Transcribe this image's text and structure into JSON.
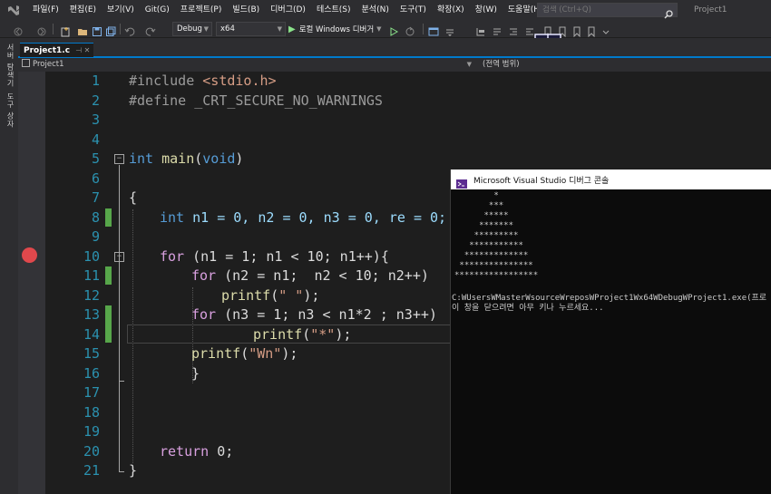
{
  "menu": {
    "items": [
      "파일(F)",
      "편집(E)",
      "보기(V)",
      "Git(G)",
      "프로젝트(P)",
      "빌드(B)",
      "디버그(D)",
      "테스트(S)",
      "분석(N)",
      "도구(T)",
      "확장(X)",
      "창(W)",
      "도움말(H)"
    ],
    "search_placeholder": "검색 (Ctrl+Q)",
    "project_title": "Project1"
  },
  "toolbar": {
    "configuration": "Debug",
    "platform": "x64",
    "run_label": "로컬 Windows 디버거"
  },
  "side_panel": {
    "tabs": [
      "서버 탐색기",
      "도구 상자"
    ]
  },
  "tab": {
    "file_name": "Project1.c",
    "close_glyphs": "⊣ ✕"
  },
  "navbar": {
    "project": "Project1",
    "scope": "(전역 범위)"
  },
  "editor": {
    "line_numbers": [
      "1",
      "2",
      "3",
      "4",
      "5",
      "6",
      "7",
      "8",
      "9",
      "10",
      "11",
      "12",
      "13",
      "14",
      "15",
      "16",
      "17",
      "18",
      "19",
      "20",
      "21"
    ],
    "code": {
      "l1_directive": "#include ",
      "l1_header": "<stdio.h>",
      "l2_directive": "#define ",
      "l2_macro": "_CRT_SECURE_NO_WARNINGS",
      "l5_type": "int",
      "l5_fn": "main",
      "l5_open": "(",
      "l5_void": "void",
      "l5_close": ")",
      "l7": "{",
      "l8_type": "int",
      "l8_rest": " n1 = 0, n2 = 0, n3 = 0, re = 0;",
      "l10_kw": "for",
      "l10_rest": " (n1 = 1; n1 < 10; n1++){",
      "l11_kw": "for",
      "l11_rest": " (n2 = n1;  n2 < 10; n2++)",
      "l12_fn": "printf",
      "l12_open": "(",
      "l12_str": "\" \"",
      "l12_close": ");",
      "l13_kw": "for",
      "l13_rest": " (n3 = 1; n3 < n1*2 ; n3++)",
      "l14_fn": "printf",
      "l14_open": "(",
      "l14_str": "\"*\"",
      "l14_close": ");",
      "l15_fn": "printf",
      "l15_open": "(",
      "l15_str": "\"Wn\"",
      "l15_close": ");",
      "l16": "}",
      "l20_kw": "return",
      "l20_rest": " 0;",
      "l21": "}"
    }
  },
  "console": {
    "title": "Microsoft Visual Studio 디버그 콘솔",
    "pyramid": [
      "        *",
      "       ***",
      "      *****",
      "     *******",
      "    *********",
      "   ***********",
      "  *************",
      " ***************",
      "*****************"
    ],
    "path_line": "C:WUsersWMasterWsourceWreposWProject1Wx64WDebugWProject1.exe(프로",
    "close_prompt": "이 창을 닫으려면 아무 키나 누르세요..."
  },
  "colors": {
    "background": "#1e1e1e",
    "chrome": "#2d2d30",
    "accent": "#007acc",
    "keyword": "#569cd6",
    "control_keyword": "#d8a0df",
    "string": "#d69d85",
    "line_number": "#2b91af",
    "change_marker": "#57a64a",
    "breakpoint": "#e0484c"
  },
  "icons": [
    "vs-logo-icon",
    "search-icon",
    "back-icon",
    "forward-icon",
    "new-project-icon",
    "open-folder-icon",
    "save-icon",
    "save-all-icon",
    "undo-icon",
    "redo-icon",
    "play-icon",
    "start-without-debug-icon",
    "hot-reload-icon",
    "breakpoint-icon",
    "console-app-icon"
  ]
}
